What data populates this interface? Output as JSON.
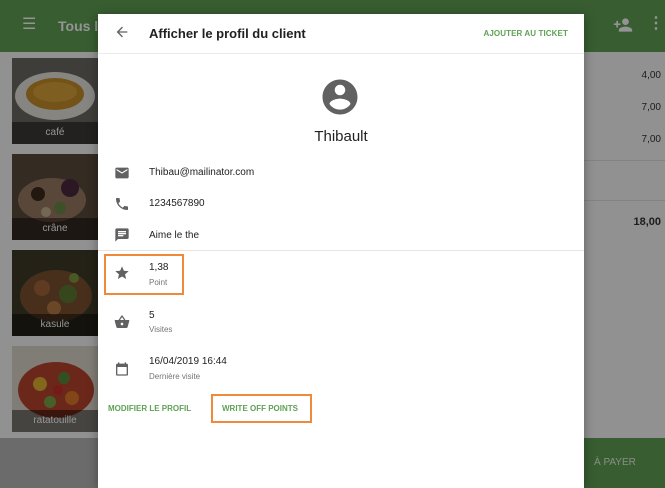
{
  "app": {
    "title": "Tous les",
    "menu_icon": "menu-icon",
    "add_user_icon": "add-user-icon",
    "more_icon": "more-vert-icon",
    "accent_color": "#5fa155",
    "highlight_color": "#ee8a3a"
  },
  "products": [
    {
      "label": "café"
    },
    {
      "label": "crâne"
    },
    {
      "label": "kasule"
    },
    {
      "label": "ratatouille"
    }
  ],
  "ticket": {
    "prices": [
      "4,00",
      "7,00",
      "7,00"
    ],
    "total": "18,00",
    "pay_label": "À PAYER"
  },
  "dialog": {
    "title": "Afficher le profil du client",
    "add_to_ticket": "AJOUTER AU TICKET",
    "customer_name": "Thibault",
    "email": "Thibau@mailinator.com",
    "phone": "1234567890",
    "note": "Aime le the",
    "points_value": "1,38",
    "points_label": "Point",
    "visits_value": "5",
    "visits_label": "Visites",
    "last_visit_value": "16/04/2019 16:44",
    "last_visit_label": "Dernière visite",
    "modify_profile": "MODIFIER LE PROFIL",
    "write_off_points": "WRITE OFF POINTS"
  }
}
